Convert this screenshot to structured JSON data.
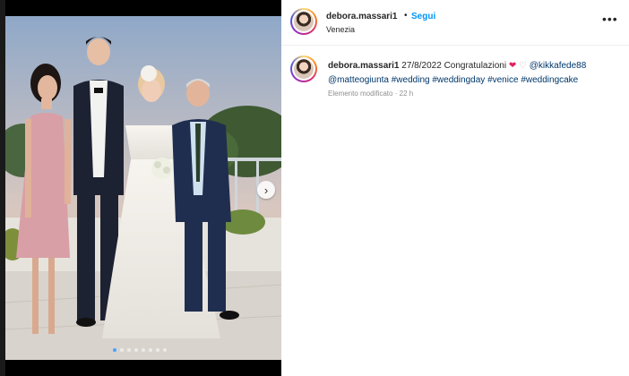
{
  "post": {
    "username": "debora.massari1",
    "separator": "•",
    "follow_label": "Segui",
    "location": "Venezia",
    "more_icon": "more-horizontal-icon"
  },
  "caption": {
    "username": "debora.massari1",
    "date": "27/8/2022",
    "text": "Congratulazioni",
    "heart_red": "❤",
    "heart_white": "♡",
    "mentions": [
      "@kikkafede88",
      "@matteogiunta"
    ],
    "hashtags": [
      "#wedding",
      "#weddingday",
      "#venice",
      "#weddingcake"
    ],
    "edited": "Elemento modificato",
    "time_sep": "·",
    "time": "22 h"
  },
  "carousel": {
    "next_icon": "chevron-right-icon",
    "total_slides": 8,
    "current_slide": 1
  },
  "colors": {
    "follow": "#0095f6",
    "link": "#00376b",
    "heart": "#e0245e",
    "meta": "#8e8e8e"
  }
}
